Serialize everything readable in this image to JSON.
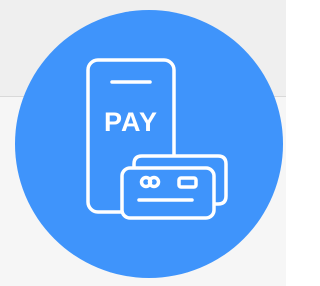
{
  "icon": {
    "name": "mobile-payment-icon",
    "text": "PAY",
    "colors": {
      "circle": "#3f94fb",
      "stroke": "#ffffff",
      "background_top": "#efefef",
      "background_bottom": "#f6f6f6"
    }
  }
}
